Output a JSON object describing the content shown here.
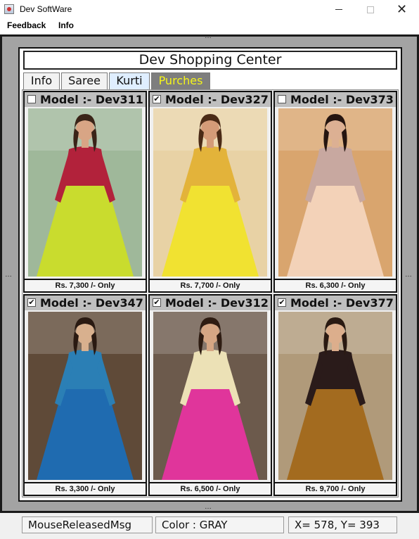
{
  "window": {
    "title": "Dev SoftWare",
    "minimize_icon": "minimize-icon",
    "maximize_icon": "maximize-icon",
    "close_glyph": "✕"
  },
  "menu": {
    "items": [
      {
        "label": "Feedback"
      },
      {
        "label": "Info"
      }
    ]
  },
  "handles": {
    "top": "…",
    "bottom": "…",
    "left": "…",
    "right": "…"
  },
  "shop": {
    "title": "Dev Shopping Center",
    "tabs": [
      {
        "label": "Info",
        "selected": false
      },
      {
        "label": "Saree",
        "selected": false
      },
      {
        "label": "Kurti",
        "selected": true
      },
      {
        "label": "Purches",
        "selected": false
      }
    ],
    "products": [
      {
        "model": "Model :- Dev311",
        "checked": false,
        "check_glyph": "",
        "price": "Rs. 7,300 /- Only",
        "colors": {
          "bg": "#9fb89a",
          "dress": "#c9dc2e",
          "top": "#b2223b",
          "skin": "#d8a585",
          "hair": "#3a2418"
        }
      },
      {
        "model": "Model :- Dev327",
        "checked": true,
        "check_glyph": "✔",
        "price": "Rs. 7,700 /- Only",
        "colors": {
          "bg": "#e8d2a5",
          "dress": "#f1e231",
          "top": "#e3b33a",
          "skin": "#d49b78",
          "hair": "#4a2a16"
        }
      },
      {
        "model": "Model :- Dev373",
        "checked": false,
        "check_glyph": "",
        "price": "Rs. 6,300 /- Only",
        "colors": {
          "bg": "#d9a56e",
          "dress": "#f3d2b8",
          "top": "#c8a8a0",
          "skin": "#dcb093",
          "hair": "#251510"
        }
      },
      {
        "model": "Model :- Dev347",
        "checked": true,
        "check_glyph": "✔",
        "price": "Rs. 3,300 /- Only",
        "colors": {
          "bg": "#5f4a38",
          "dress": "#1f6bb0",
          "top": "#2b7fb5",
          "skin": "#d8b08e",
          "hair": "#2a1a12"
        }
      },
      {
        "model": "Model :- Dev312",
        "checked": true,
        "check_glyph": "✔",
        "price": "Rs. 6,500 /- Only",
        "colors": {
          "bg": "#6c5a4c",
          "dress": "#e0359b",
          "top": "#ece1b6",
          "skin": "#d5a684",
          "hair": "#2e1c12"
        }
      },
      {
        "model": "Model :- Dev377",
        "checked": true,
        "check_glyph": "✔",
        "price": "Rs. 9,700 /- Only",
        "colors": {
          "bg": "#b09a7a",
          "dress": "#a36b1f",
          "top": "#2a1b1a",
          "skin": "#dcae8c",
          "hair": "#2a1a12"
        }
      }
    ]
  },
  "status": {
    "message": "MouseReleasedMsg",
    "color": "Color : GRAY",
    "coords": "X= 578, Y= 393"
  }
}
